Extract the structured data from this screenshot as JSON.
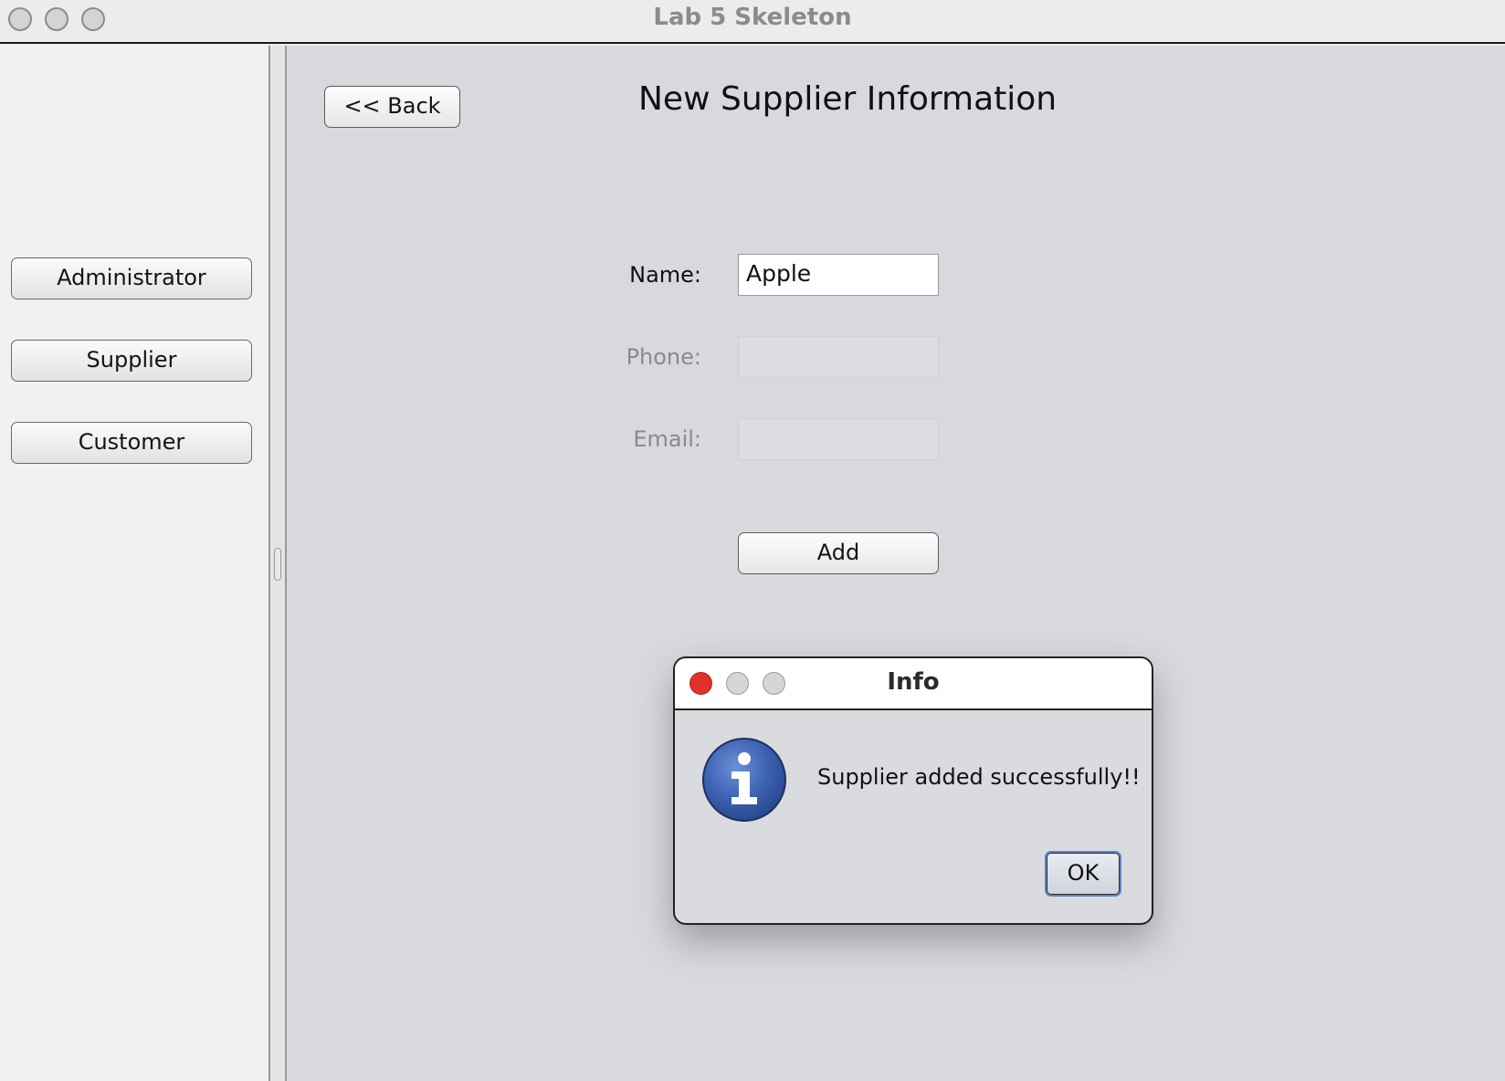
{
  "window": {
    "title": "Lab 5 Skeleton"
  },
  "sidebar": {
    "items": [
      {
        "label": "Administrator"
      },
      {
        "label": "Supplier"
      },
      {
        "label": "Customer"
      }
    ]
  },
  "content": {
    "back_label": "<< Back",
    "page_title": "New Supplier Information",
    "form": {
      "name_label": "Name:",
      "name_value": "Apple",
      "phone_label": "Phone:",
      "phone_value": "",
      "email_label": "Email:",
      "email_value": "",
      "add_label": "Add"
    }
  },
  "dialog": {
    "title": "Info",
    "message": "Supplier added successfully!!",
    "ok_label": "OK",
    "icon": "info-icon"
  },
  "colors": {
    "close_red": "#e0302a",
    "info_blue": "#3c62b3",
    "focus_blue": "#5b82c4"
  }
}
